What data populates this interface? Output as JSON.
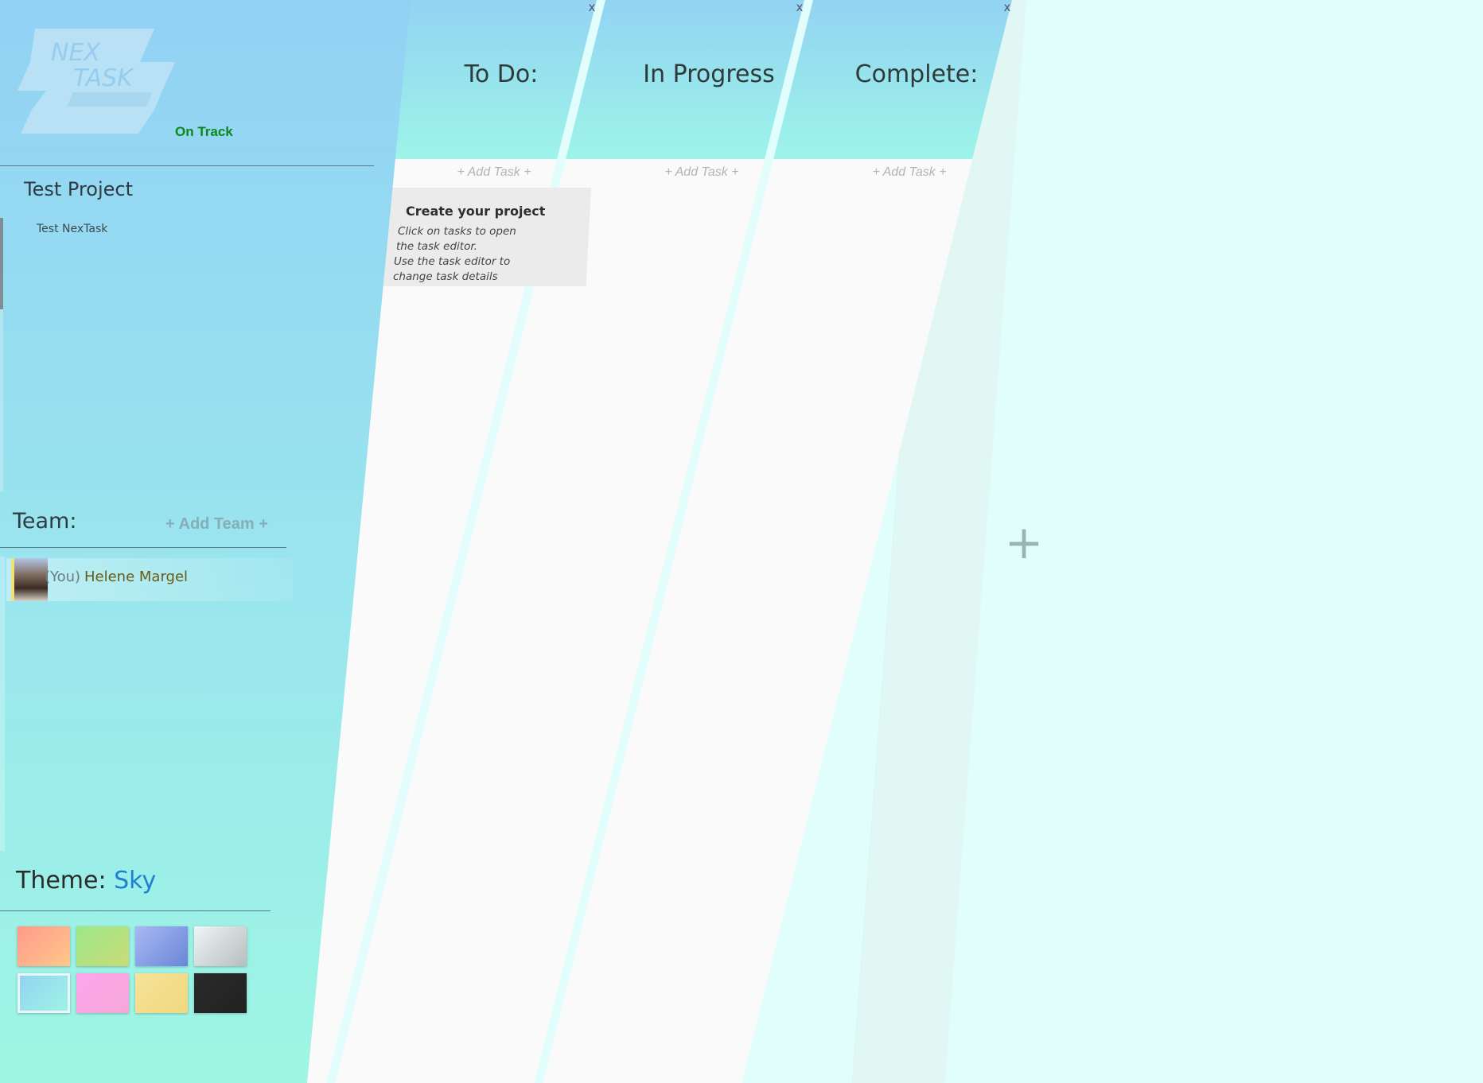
{
  "sidebar": {
    "logo_text": [
      "NEX",
      "TASK"
    ],
    "status": "On Track",
    "project": {
      "name": "Test Project",
      "items": [
        "Test NexTask"
      ]
    },
    "team": {
      "label": "Team:",
      "add_label": "+ Add Team +",
      "members": [
        {
          "you_tag": "(You)",
          "name": "Helene Margel"
        }
      ]
    },
    "theme": {
      "label": "Theme:",
      "value": "Sky",
      "swatches": [
        {
          "name": "coral",
          "from": "#ff9a8b",
          "to": "#fdc88a"
        },
        {
          "name": "lime",
          "from": "#9ee68a",
          "to": "#c8dc78"
        },
        {
          "name": "periwinkle",
          "from": "#a8b8f4",
          "to": "#6a86d8"
        },
        {
          "name": "silver",
          "from": "#eef6f6",
          "to": "#b8bcbc"
        },
        {
          "name": "sky",
          "from": "#92d1f4",
          "to": "#9ef6e3",
          "selected": true
        },
        {
          "name": "pink",
          "from": "#fca5ec",
          "to": "#f6a8d8"
        },
        {
          "name": "sand",
          "from": "#f6e39a",
          "to": "#f0d87e"
        },
        {
          "name": "dark",
          "from": "#2a2a2a",
          "to": "#222222"
        }
      ]
    }
  },
  "board": {
    "close_label": "x",
    "add_task_label": "+ Add Task +",
    "add_list_label": "+",
    "columns": [
      {
        "title": "To Do:"
      },
      {
        "title": "In Progress"
      },
      {
        "title": "Complete:"
      }
    ],
    "cards": [
      {
        "title": "Create your project",
        "lines": [
          "Click on tasks to open",
          "the task editor.",
          "Use the task editor to",
          "change task details"
        ]
      }
    ]
  },
  "colors": {
    "accent": "#1f7fd0",
    "status": "#0a8a16",
    "column_head_top": "#93d3f3",
    "column_head_bottom": "#9df4e8",
    "page_background": "#e1fefc"
  }
}
